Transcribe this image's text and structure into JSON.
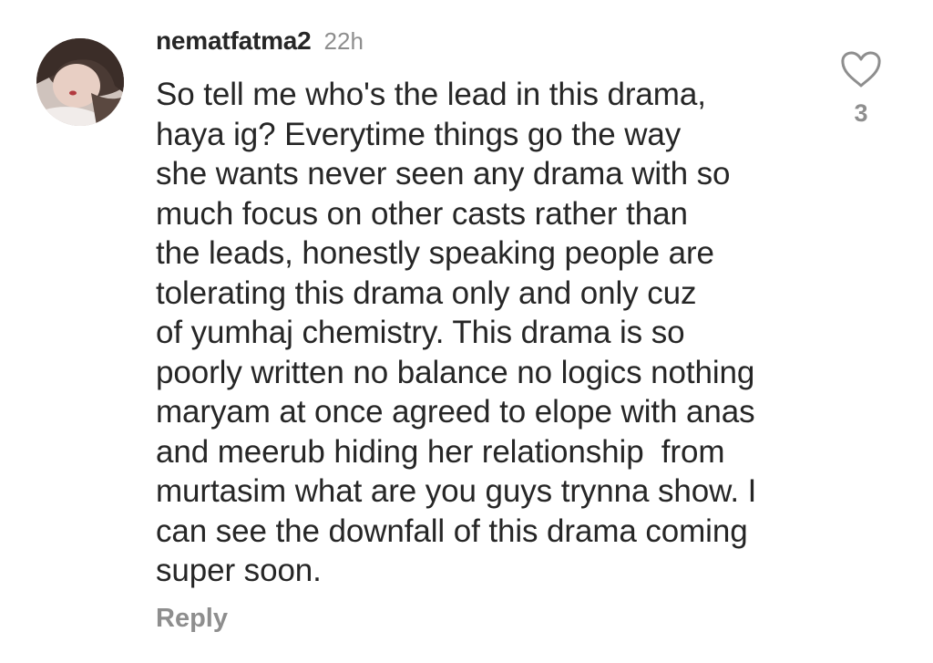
{
  "comment": {
    "username": "nematfatma2",
    "timestamp": "22h",
    "text_lines": [
      "So tell me who's the lead in this drama,",
      "haya ig? Everytime things go the way",
      "she wants never seen any drama with so",
      "much focus on other casts rather than",
      "the leads, honestly speaking people are",
      "tolerating this drama only and only cuz",
      "of yumhaj chemistry. This drama is so",
      "poorly written no balance no logics nothing",
      "maryam at once agreed to elope with anas",
      "and meerub hiding her relationship  from",
      "murtasim what are you guys trynna show. I",
      "can see the downfall of this drama coming",
      "super soon."
    ],
    "reply_label": "Reply",
    "like_count": "3",
    "like_icon": "heart-outline-icon"
  },
  "colors": {
    "primary_text": "#262626",
    "secondary_text": "#8e8e8e"
  }
}
